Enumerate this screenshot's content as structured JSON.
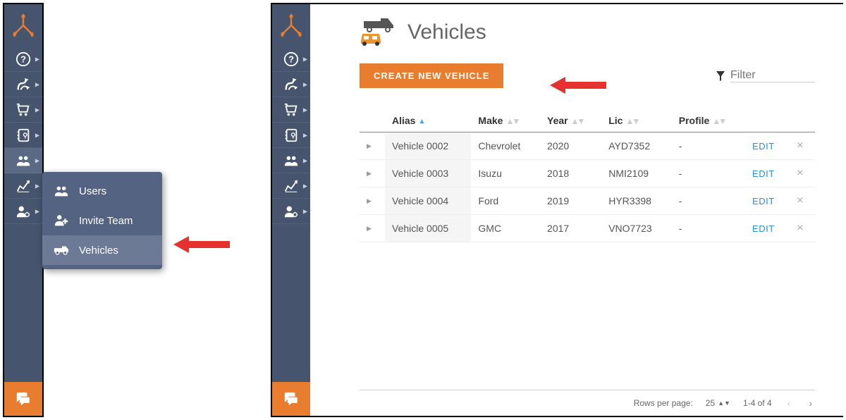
{
  "page": {
    "title": "Vehicles",
    "create_button": "CREATE NEW VEHICLE",
    "filter_placeholder": "Filter",
    "edit_label": "EDIT"
  },
  "flyout": {
    "items": [
      {
        "label": "Users",
        "icon": "users-icon"
      },
      {
        "label": "Invite Team",
        "icon": "invite-team-icon"
      },
      {
        "label": "Vehicles",
        "icon": "truck-icon"
      }
    ]
  },
  "table": {
    "columns": [
      "Alias",
      "Make",
      "Year",
      "Lic",
      "Profile"
    ],
    "rows": [
      {
        "alias": "Vehicle 0002",
        "make": "Chevrolet",
        "year": "2020",
        "lic": "AYD7352",
        "profile": "-"
      },
      {
        "alias": "Vehicle 0003",
        "make": "Isuzu",
        "year": "2018",
        "lic": "NMI2109",
        "profile": "-"
      },
      {
        "alias": "Vehicle 0004",
        "make": "Ford",
        "year": "2019",
        "lic": "HYR3398",
        "profile": "-"
      },
      {
        "alias": "Vehicle 0005",
        "make": "GMC",
        "year": "2017",
        "lic": "VNO7723",
        "profile": "-"
      }
    ]
  },
  "pager": {
    "rows_per_page_label": "Rows per page:",
    "rows_per_page_value": "25",
    "range_text": "1-4 of 4"
  }
}
